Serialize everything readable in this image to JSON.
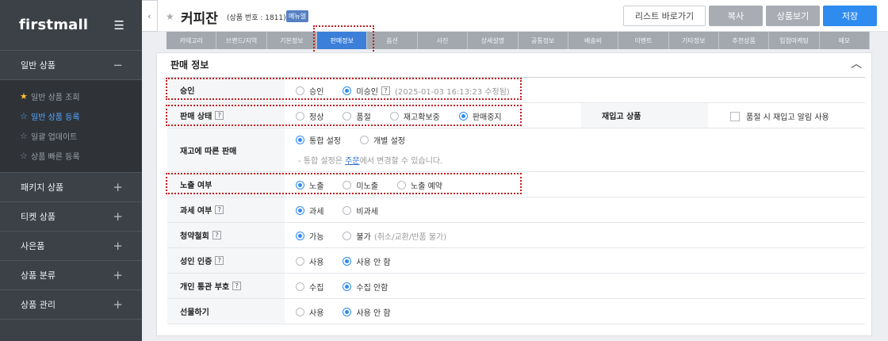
{
  "sidebar": {
    "logo": "firstmall",
    "sections": [
      {
        "label": "일반 상품",
        "sign": "−"
      },
      {
        "label": "패키지 상품",
        "sign": "+"
      },
      {
        "label": "티켓 상품",
        "sign": "+"
      },
      {
        "label": "사은품",
        "sign": "+"
      },
      {
        "label": "상품 분류",
        "sign": "+"
      },
      {
        "label": "상품 관리",
        "sign": "+"
      }
    ],
    "submenu": [
      {
        "label": "일반 상품 조회",
        "star": "★"
      },
      {
        "label": "일반 상품 등록",
        "star": "☆"
      },
      {
        "label": "일괄 업데이트",
        "star": "☆"
      },
      {
        "label": "상품 빠른 등록",
        "star": "☆"
      }
    ]
  },
  "header": {
    "collapse": "‹",
    "title_star": "★",
    "title": "커피잔",
    "product_no": "(상품 번호 : 1811)",
    "badge": "메뉴얼",
    "buttons": {
      "list": "리스트 바로가기",
      "copy": "복사",
      "view": "상품보기",
      "save": "저장"
    }
  },
  "tabs": [
    "카테고리",
    "브랜드/지역",
    "기본정보",
    "판매정보",
    "옵션",
    "사진",
    "상세설명",
    "공통정보",
    "배송비",
    "이벤트",
    "기타정보",
    "추천상품",
    "입점마케팅",
    "메모"
  ],
  "active_tab": "판매정보",
  "panel": {
    "title": "판매 정보",
    "caret": "︿",
    "rows": {
      "approval": {
        "label": "승인",
        "options": [
          "승인",
          "미승인"
        ],
        "selected": 1,
        "help": "?",
        "note": "(2025-01-03 16:13:23 수정됨)"
      },
      "sale_status": {
        "label": "판매 상태",
        "help": "?",
        "options": [
          "정상",
          "품절",
          "재고확보중",
          "판매중지"
        ],
        "selected": 3
      },
      "restock": {
        "label": "재입고 상품",
        "checkbox_label": "품절 시 재입고 알림 사용"
      },
      "stock_sale": {
        "label": "재고에 따른 판매",
        "options": [
          "통합 설정",
          "개별 설정"
        ],
        "selected": 0,
        "note_prefix": "- 통합 설정은 ",
        "note_link": "주문",
        "note_suffix": "에서 변경할 수 있습니다."
      },
      "exposure": {
        "label": "노출 여부",
        "options": [
          "노출",
          "미노출",
          "노출 예약"
        ],
        "selected": 0
      },
      "tax": {
        "label": "과세 여부",
        "help": "?",
        "options": [
          "과세",
          "비과세"
        ],
        "selected": 0
      },
      "withdrawal": {
        "label": "청약철회",
        "help": "?",
        "options": [
          "가능",
          "불가"
        ],
        "selected": 0,
        "note": "(취소/교환/반품 불가)"
      },
      "adult": {
        "label": "성인 인증",
        "help": "?",
        "options": [
          "사용",
          "사용 안 함"
        ],
        "selected": 1
      },
      "customs": {
        "label": "개인 통관 부호",
        "help": "?",
        "options": [
          "수집",
          "수집 안함"
        ],
        "selected": 1
      },
      "gift": {
        "label": "선물하기",
        "options": [
          "사용",
          "사용 안 함"
        ],
        "selected": 1
      }
    }
  },
  "colors": {
    "sidebar_bg": "#3c4148",
    "accent": "#2e8cf0",
    "active_tab": "#3b7fd9",
    "highlight": "#c21d1d",
    "favorite_star": "#f7c22d"
  }
}
